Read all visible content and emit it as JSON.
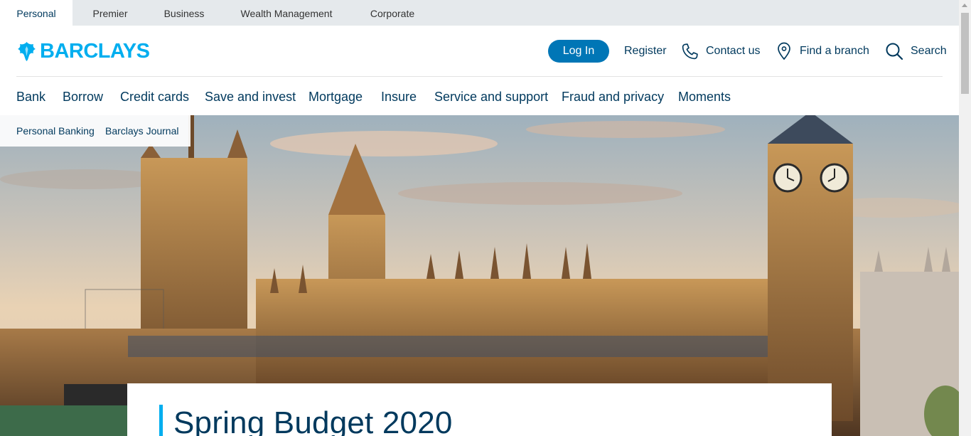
{
  "segments": [
    {
      "label": "Personal",
      "active": true
    },
    {
      "label": "Premier"
    },
    {
      "label": "Business"
    },
    {
      "label": "Wealth Management"
    },
    {
      "label": "Corporate"
    }
  ],
  "header": {
    "logo_text": "BARCLAYS",
    "login_label": "Log In",
    "register_label": "Register",
    "contact_label": "Contact us",
    "branch_label": "Find a branch",
    "search_label": "Search"
  },
  "nav": {
    "items": [
      "Bank",
      "Borrow",
      "Credit cards",
      "Save and invest",
      "Mortgage",
      "Insure",
      "Service and support",
      "Fraud and privacy",
      "Moments"
    ]
  },
  "subnav": {
    "items": [
      "Personal Banking",
      "Barclays Journal"
    ]
  },
  "hero": {
    "title": "Spring Budget 2020",
    "image": "houses-of-parliament-photo"
  },
  "colors": {
    "brand": "#00aeef",
    "navy": "#00395d",
    "button": "#0076b6"
  }
}
